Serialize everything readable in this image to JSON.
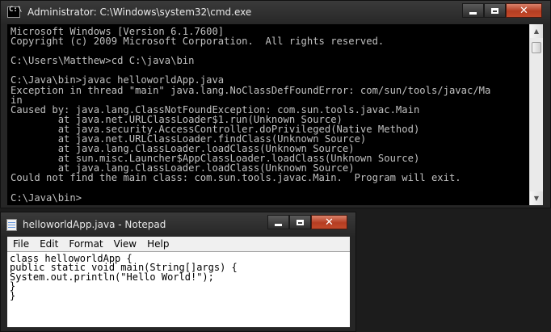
{
  "cmd": {
    "title": "Administrator: C:\\Windows\\system32\\cmd.exe",
    "prompt_icon_glyph": "C:\\",
    "console_lines": [
      "Microsoft Windows [Version 6.1.7600]",
      "Copyright (c) 2009 Microsoft Corporation.  All rights reserved.",
      "",
      "C:\\Users\\Matthew>cd C:\\java\\bin",
      "",
      "C:\\Java\\bin>javac helloworldApp.java",
      "Exception in thread \"main\" java.lang.NoClassDefFoundError: com/sun/tools/javac/Ma",
      "in",
      "Caused by: java.lang.ClassNotFoundException: com.sun.tools.javac.Main",
      "        at java.net.URLClassLoader$1.run(Unknown Source)",
      "        at java.security.AccessController.doPrivileged(Native Method)",
      "        at java.net.URLClassLoader.findClass(Unknown Source)",
      "        at java.lang.ClassLoader.loadClass(Unknown Source)",
      "        at sun.misc.Launcher$AppClassLoader.loadClass(Unknown Source)",
      "        at java.lang.ClassLoader.loadClass(Unknown Source)",
      "Could not find the main class: com.sun.tools.javac.Main.  Program will exit.",
      "",
      "C:\\Java\\bin>"
    ],
    "controls": {
      "close_glyph": "✕"
    }
  },
  "notepad": {
    "title": "helloworldApp.java - Notepad",
    "menu": [
      "File",
      "Edit",
      "Format",
      "View",
      "Help"
    ],
    "lines": [
      "class helloworldApp {",
      "public static void main(String[]args) {",
      "System.out.println(\"Hello World!\");",
      "}",
      "}"
    ],
    "controls": {
      "close_glyph": "✕"
    }
  },
  "colors": {
    "console_bg": "#000000",
    "console_text": "#c0c0c0",
    "close_button": "#c2492a"
  }
}
